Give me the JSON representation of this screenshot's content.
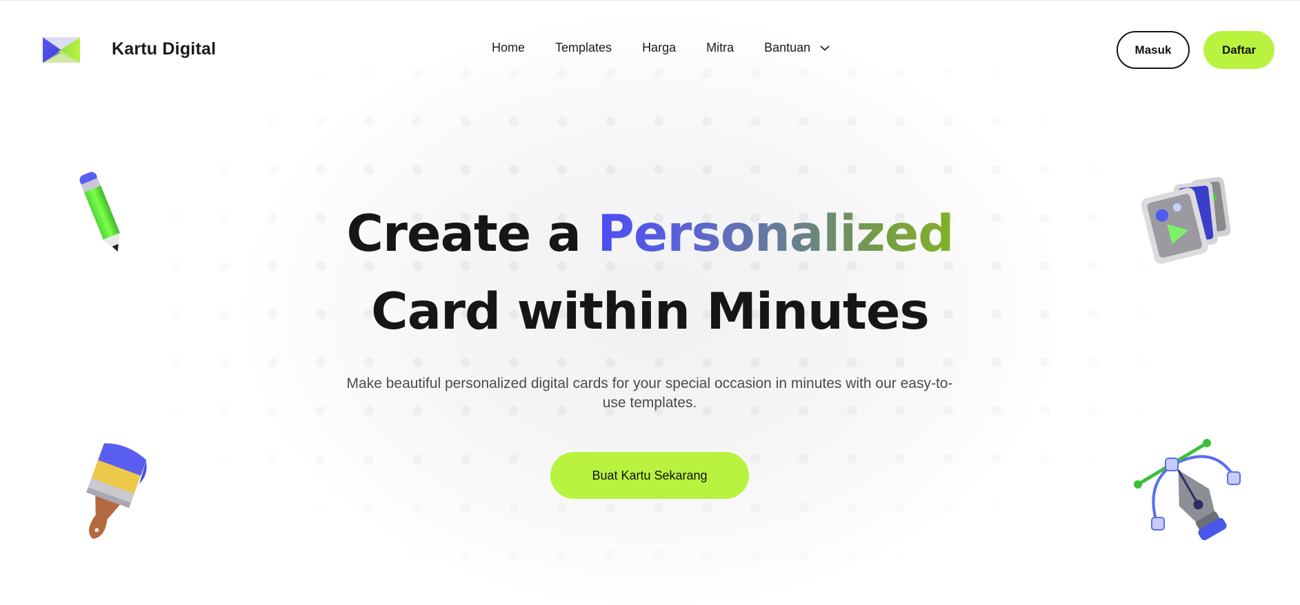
{
  "header": {
    "brand_name": "Kartu Digital",
    "logo_icon": "envelope-logo-icon",
    "nav": [
      {
        "label": "Home"
      },
      {
        "label": "Templates"
      },
      {
        "label": "Harga"
      },
      {
        "label": "Mitra"
      },
      {
        "label": "Bantuan",
        "has_dropdown": true,
        "dropdown_icon": "chevron-down-icon"
      }
    ],
    "login_label": "Masuk",
    "register_label": "Daftar"
  },
  "hero": {
    "headline_prefix": "Create a",
    "headline_highlight": "Personalized",
    "headline_line2": "Card within Minutes",
    "subtitle": "Make beautiful personalized digital cards for your special occasion in minutes with our easy-to-use templates.",
    "cta_label": "Buat Kartu Sekarang"
  },
  "decorations": [
    "pencil-icon",
    "image-cards-icon",
    "paint-brush-icon",
    "pen-tool-icon"
  ],
  "colors": {
    "accent_green": "#b9f33f",
    "gradient_start": "#4a4cf2",
    "gradient_end": "#82b325",
    "text_dark": "#161616"
  }
}
